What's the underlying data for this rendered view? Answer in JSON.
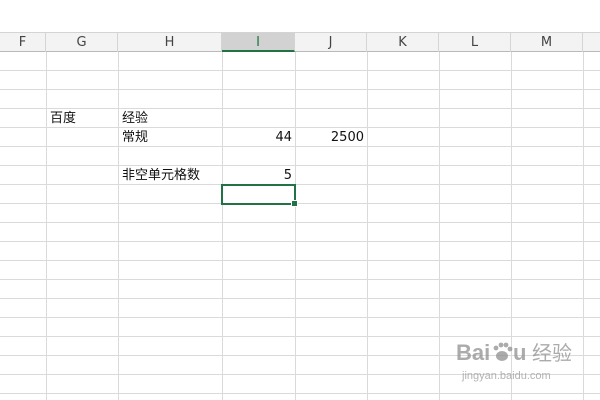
{
  "spreadsheet": {
    "columns": [
      {
        "label": "F",
        "active": false
      },
      {
        "label": "G",
        "active": false
      },
      {
        "label": "H",
        "active": false
      },
      {
        "label": "I",
        "active": true
      },
      {
        "label": "J",
        "active": false
      },
      {
        "label": "K",
        "active": false
      },
      {
        "label": "L",
        "active": false
      },
      {
        "label": "M",
        "active": false
      }
    ],
    "cells": {
      "g1": "百度",
      "h1": "经验",
      "h2": "常规",
      "i2": "44",
      "j2": "2500",
      "h4": "非空单元格数",
      "i4": "5"
    },
    "selected_cell": "I"
  },
  "watermark": {
    "brand": "Baidu 经验",
    "url": "jingyan.baidu.com",
    "logo_icon": "baidu-paw-icon"
  }
}
